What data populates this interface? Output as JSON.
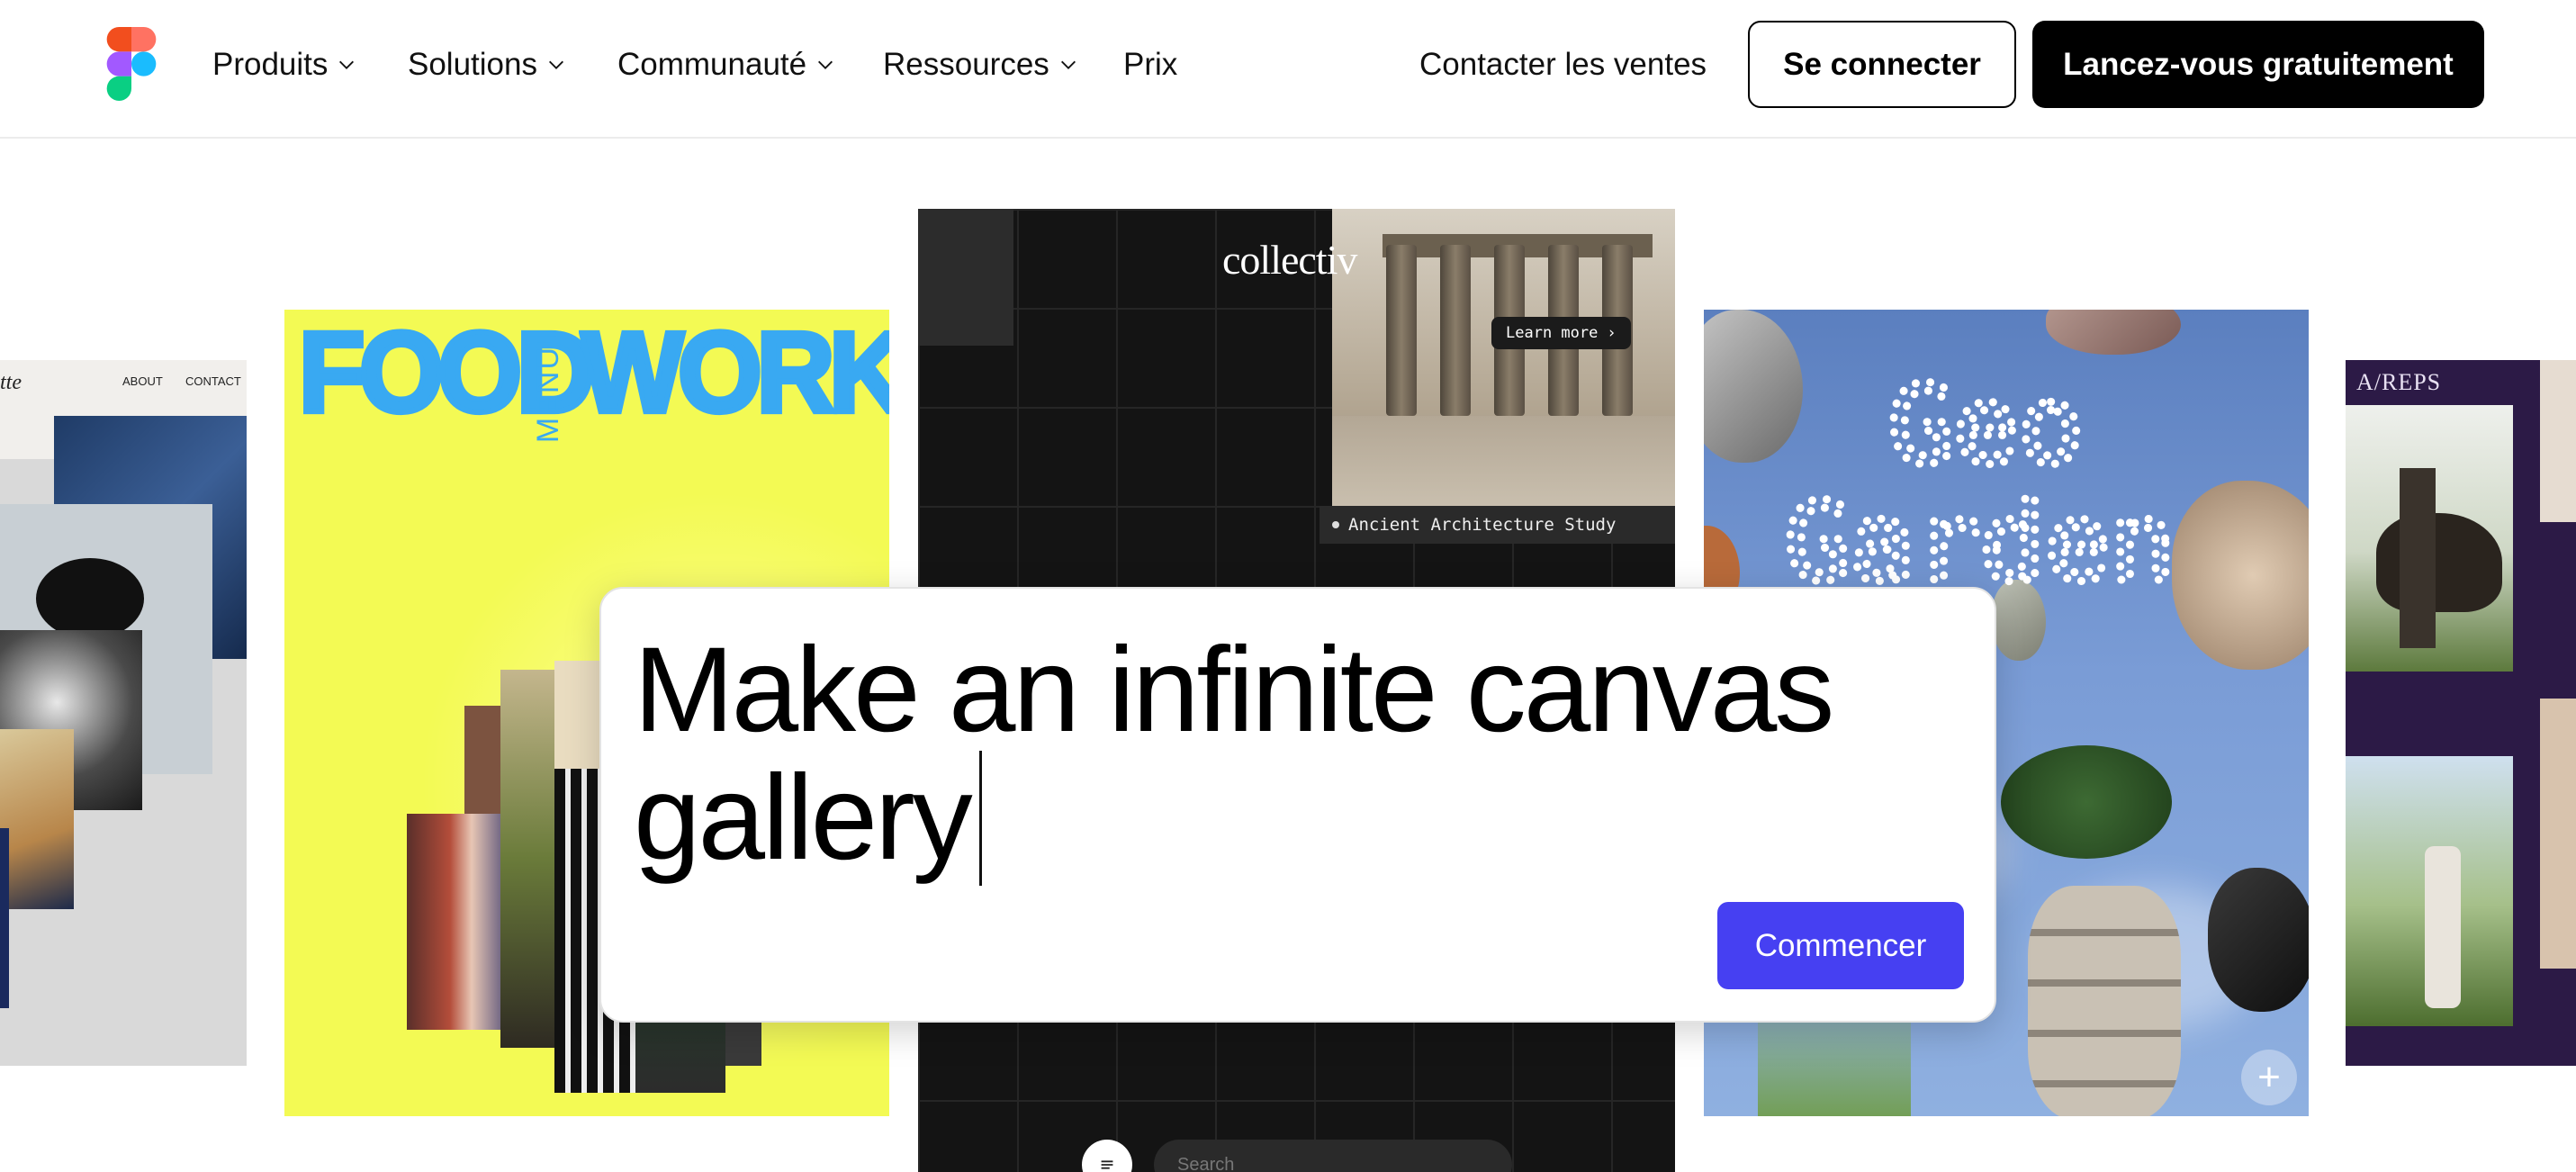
{
  "nav": {
    "items": [
      {
        "label": "Produits"
      },
      {
        "label": "Solutions"
      },
      {
        "label": "Communauté"
      },
      {
        "label": "Ressources"
      },
      {
        "label": "Prix"
      }
    ],
    "contact": "Contacter les ventes",
    "login": "Se connecter",
    "cta": "Lancez-vous gratuitement"
  },
  "cards": {
    "left": {
      "brand": "tte",
      "about": "ABOUT",
      "contact": "CONTACT"
    },
    "food": {
      "title_left": "FOOD",
      "title_menu": "MENU",
      "title_right": "WORKS"
    },
    "collectiv": {
      "logo": "collectiv",
      "learn_more": "Learn more",
      "caption": "Ancient Architecture Study",
      "search_placeholder": "Search"
    },
    "geo": {
      "line1": "Geo",
      "line2": "Garden"
    },
    "reps": {
      "label": "A/REPS"
    }
  },
  "prompt": {
    "line1": "Make an infinite canvas",
    "line2": "gallery",
    "button": "Commencer"
  },
  "colors": {
    "accent": "#4640f2",
    "food_bg": "#f3fa54",
    "food_text": "#39a9f2",
    "geo_sky": "#7a9cd6",
    "reps_bg": "#2c1a46"
  }
}
